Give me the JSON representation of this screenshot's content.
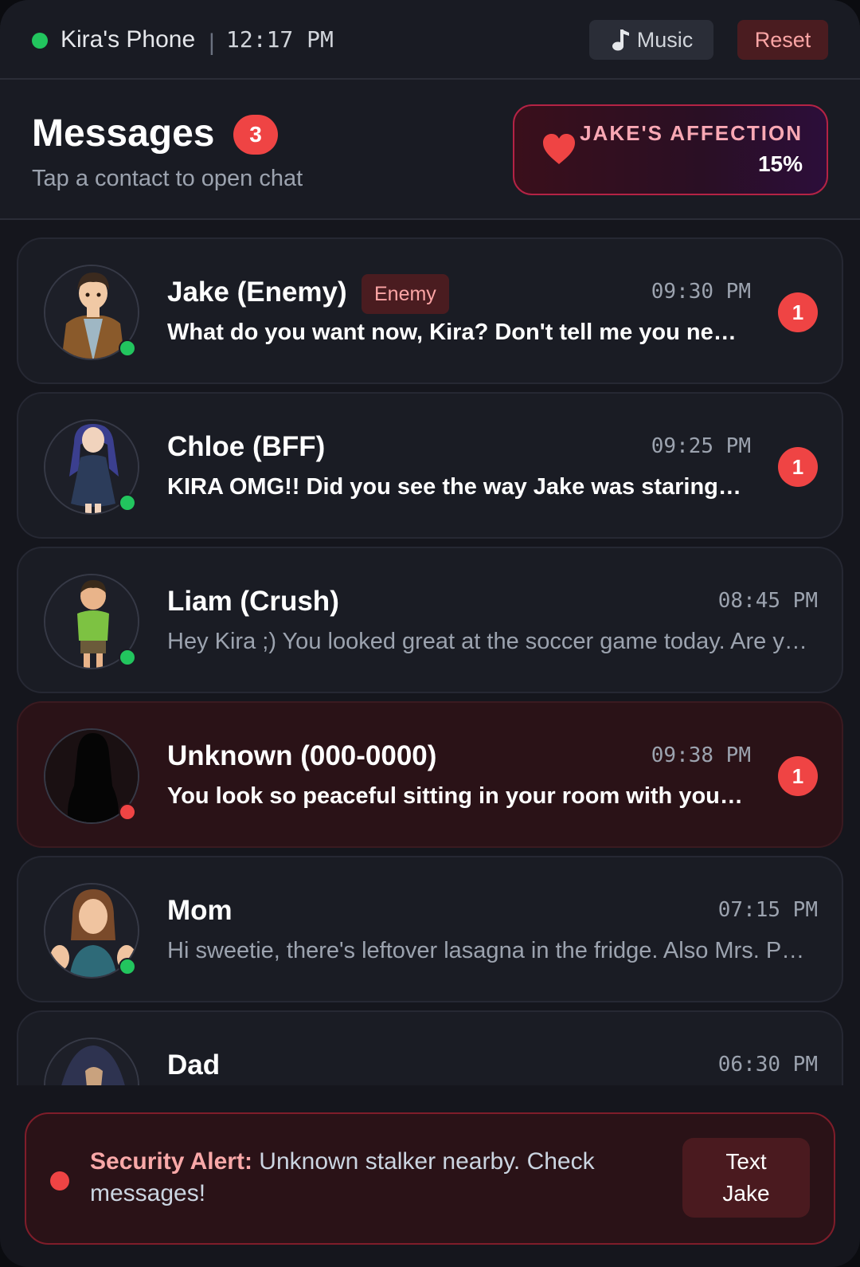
{
  "status_bar": {
    "device_name": "Kira's Phone",
    "separator": "|",
    "time": "12:17 PM",
    "music_label": "Music",
    "reset_label": "Reset"
  },
  "header": {
    "title": "Messages",
    "unread_badge": "3",
    "subtitle": "Tap a contact to open chat",
    "affection_label": "JAKE'S AFFECTION",
    "affection_value": "15%"
  },
  "contacts": [
    {
      "name": "Jake (Enemy)",
      "tag": "Enemy",
      "time": "09:30 PM",
      "preview": "What do you want now, Kira? Don't tell me you need help with math again.",
      "unread": "1",
      "status": "online"
    },
    {
      "name": "Chloe (BFF)",
      "time": "09:25 PM",
      "preview": "KIRA OMG!! Did you see the way Jake was staring at you in class today?!",
      "unread": "1",
      "status": "online"
    },
    {
      "name": "Liam (Crush)",
      "time": "08:45 PM",
      "preview": "Hey Kira ;) You looked great at the soccer game today. Are you free this weekend?",
      "status": "online"
    },
    {
      "name": "Unknown (000-0000)",
      "time": "09:38 PM",
      "preview": "You look so peaceful sitting in your room with your lamp on.",
      "unread": "1",
      "status": "danger"
    },
    {
      "name": "Mom",
      "time": "07:15 PM",
      "preview": "Hi sweetie, there's leftover lasagna in the fridge. Also Mrs. Patel called about your grades.",
      "status": "online"
    },
    {
      "name": "Dad",
      "time": "06:30 PM"
    }
  ],
  "footer": {
    "alert_title": "Security Alert:",
    "alert_message": "Unknown stalker nearby. Check messages!",
    "action_label": "Text Jake"
  },
  "colors": {
    "online": "#22c55e",
    "danger": "#ef4444",
    "accent_red": "#b42345",
    "background": "#15161d"
  }
}
